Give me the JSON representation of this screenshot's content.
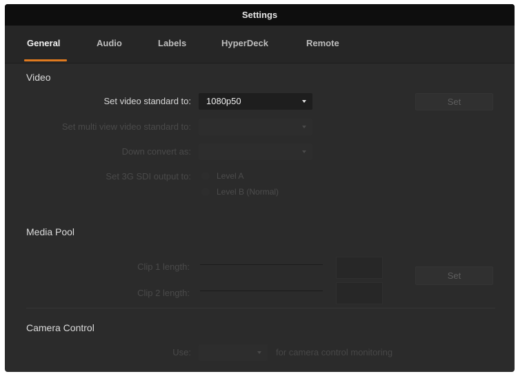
{
  "window": {
    "title": "Settings"
  },
  "tabs": [
    {
      "label": "General",
      "active": true
    },
    {
      "label": "Audio",
      "active": false
    },
    {
      "label": "Labels",
      "active": false
    },
    {
      "label": "HyperDeck",
      "active": false
    },
    {
      "label": "Remote",
      "active": false
    }
  ],
  "colors": {
    "accent": "#e07a1f",
    "background": "#2b2b2b",
    "titlebar": "#0e0e0e"
  },
  "video": {
    "title": "Video",
    "video_standard_label": "Set video standard to:",
    "video_standard_value": "1080p50",
    "set_button": "Set",
    "multiview_label": "Set multi view video standard to:",
    "multiview_value": "",
    "down_convert_label": "Down convert as:",
    "down_convert_value": "",
    "sdi_label": "Set 3G SDI output to:",
    "sdi_options": [
      "Level A",
      "Level B (Normal)"
    ]
  },
  "media_pool": {
    "title": "Media Pool",
    "clip1_label": "Clip 1 length:",
    "clip2_label": "Clip 2 length:",
    "set_button": "Set"
  },
  "camera_control": {
    "title": "Camera Control",
    "use_label": "Use:",
    "use_value": "",
    "suffix": "for camera control monitoring"
  }
}
